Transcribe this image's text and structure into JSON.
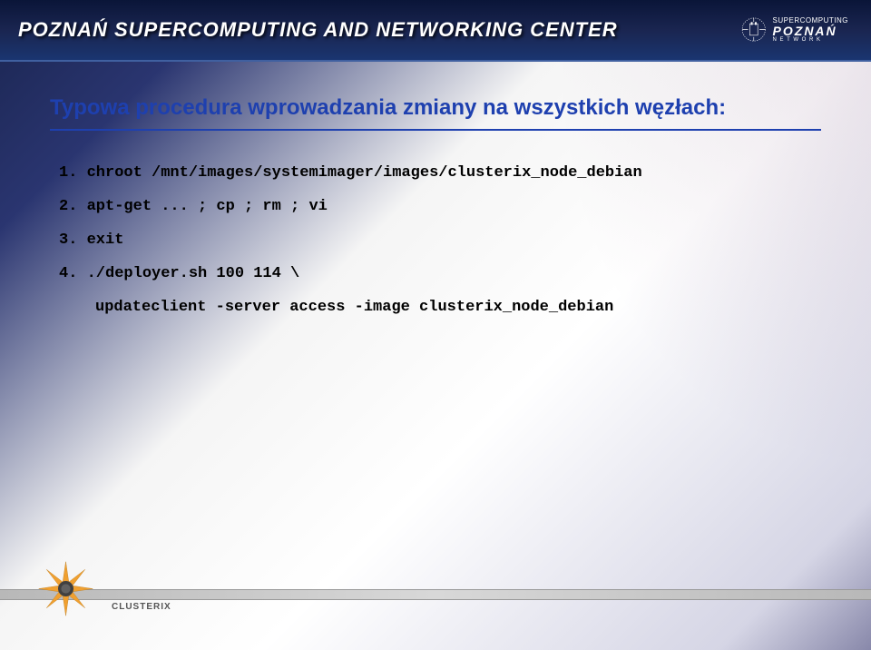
{
  "header": {
    "title": "POZNAŃ SUPERCOMPUTING AND NETWORKING CENTER",
    "logo_top": "SUPERCOMPUTING",
    "logo_main": "POZNAŃ",
    "logo_sub": "N E T W O R K"
  },
  "slide": {
    "title": "Typowa procedura wprowadzania zmiany na wszystkich węzłach:",
    "lines": [
      "1. chroot /mnt/images/systemimager/images/clusterix_node_debian",
      "2. apt-get ... ; cp ; rm ; vi",
      "3. exit",
      "4. ./deployer.sh 100 114 \\"
    ],
    "line_indent": "updateclient -server access -image clusterix_node_debian"
  },
  "footer": {
    "logo_text": "CLUSTERIX"
  }
}
